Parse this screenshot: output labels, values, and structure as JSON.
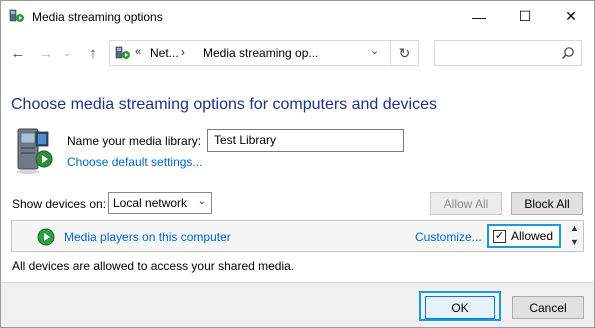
{
  "window": {
    "title": "Media streaming options",
    "icon": "media-streaming-icon",
    "minimize": "—",
    "maximize": "☐",
    "close": "✕"
  },
  "nav": {
    "back": "←",
    "forward": "→",
    "recent": "⌄",
    "up": "↑",
    "address": {
      "chevron": "«",
      "crumb1": "Net...",
      "separator": "›",
      "crumb2": "Media streaming op...",
      "dropdown": "⌄"
    },
    "refresh": "↻",
    "search_placeholder": ""
  },
  "main": {
    "heading": "Choose media streaming options for computers and devices",
    "library_name_label": "Name your media library:",
    "library_name_value": "Test Library",
    "choose_default_link": "Choose default settings...",
    "show_devices_label": "Show devices on:",
    "show_devices_value": "Local network",
    "allow_all_label": "Allow All",
    "block_all_label": "Block All",
    "device": {
      "name": "Media players on this computer",
      "customize_link": "Customize...",
      "allowed_label": "Allowed",
      "allowed_checked": "✓"
    },
    "status": "All devices are allowed to access your shared media."
  },
  "footer": {
    "ok_label": "OK",
    "cancel_label": "Cancel"
  },
  "colors": {
    "heading": "#1e3287",
    "link": "#0066cc",
    "highlight": "#1a9ad6"
  }
}
